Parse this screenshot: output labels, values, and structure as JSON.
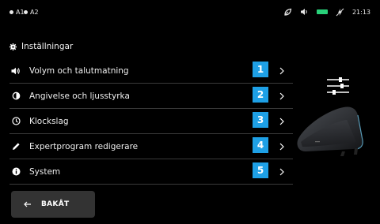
{
  "statusbar": {
    "sim1": "A1",
    "sim2": "A2",
    "time": "21:13",
    "battery_color": "#29d17a"
  },
  "header": {
    "icon": "gear-icon",
    "title": "Inställningar"
  },
  "menu": {
    "items": [
      {
        "icon": "speaker-icon",
        "label": "Volym och talutmatning",
        "number": "1"
      },
      {
        "icon": "brightness-icon",
        "label": "Angivelse och ljusstyrka",
        "number": "2"
      },
      {
        "icon": "clock-icon",
        "label": "Klockslag",
        "number": "3"
      },
      {
        "icon": "pencil-icon",
        "label": "Expertprogram redigerare",
        "number": "4"
      },
      {
        "icon": "info-icon",
        "label": "System",
        "number": "5"
      }
    ],
    "accent_color": "#1ea0e6"
  },
  "back_button": {
    "label": "BAKÅT"
  }
}
